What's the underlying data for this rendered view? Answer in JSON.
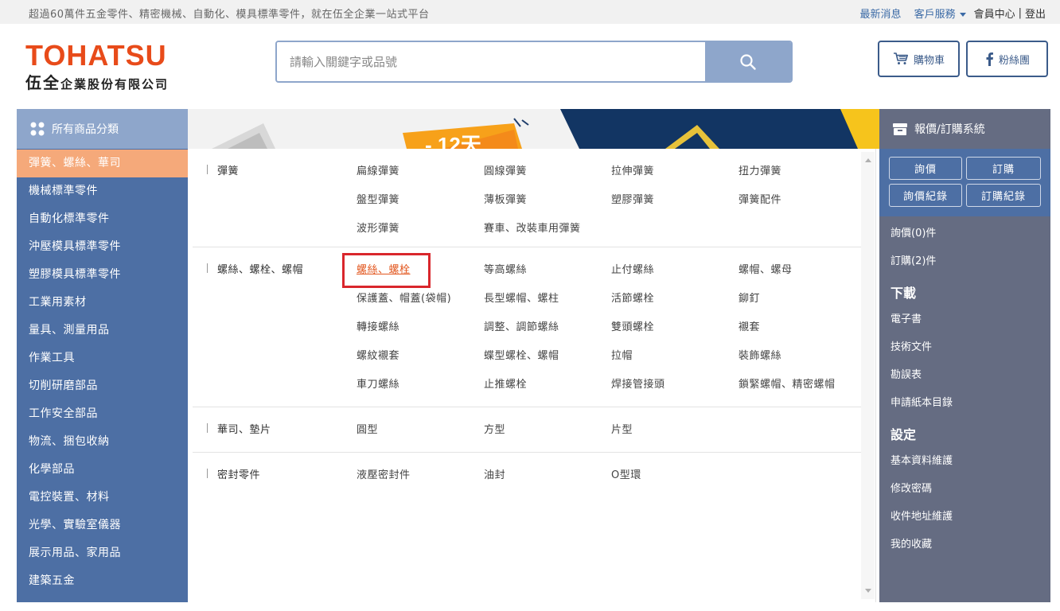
{
  "topbar": {
    "slogan": "超過60萬件五金零件、精密機械、自動化、模具標準零件，就在伍全企業一站式平台",
    "news": "最新消息",
    "service": "客戶服務",
    "member": "會員中心",
    "separator": "|",
    "logout": "登出"
  },
  "logo": {
    "brand": "TOHATSU",
    "company_big": "伍全",
    "company_rest": "企業股份有限公司"
  },
  "search": {
    "placeholder": "請輸入關鍵字或品號"
  },
  "header_buttons": {
    "cart": "購物車",
    "fans": "粉絲團"
  },
  "left_menu": {
    "title": "所有商品分類",
    "items": [
      "彈簧、螺絲、華司",
      "機械標準零件",
      "自動化標準零件",
      "沖壓模具標準零件",
      "塑膠模具標準零件",
      "工業用素材",
      "量具、測量用品",
      "作業工具",
      "切削研磨部品",
      "工作安全部品",
      "物流、捆包收納",
      "化學部品",
      "電控裝置、材料",
      "光學、實驗室儀器",
      "展示用品、家用品",
      "建築五金"
    ],
    "active_index": 0
  },
  "mega_menu": {
    "sections": [
      {
        "title": "彈簧",
        "items": [
          "扁線彈簧",
          "圓線彈簧",
          "拉伸彈簧",
          "扭力彈簧",
          "盤型彈簧",
          "薄板彈簧",
          "塑膠彈簧",
          "彈簧配件",
          "波形彈簧",
          "賽車、改裝車用彈簧"
        ]
      },
      {
        "title": "螺絲、螺栓、螺帽",
        "items": [
          "螺絲、螺栓",
          "等高螺絲",
          "止付螺絲",
          "螺帽、螺母",
          "保護蓋、帽蓋(袋帽)",
          "長型螺帽、螺柱",
          "活節螺栓",
          "鉚釘",
          "轉接螺絲",
          "調整、調節螺絲",
          "雙頭螺栓",
          "襯套",
          "螺紋襯套",
          "蝶型螺栓、螺帽",
          "拉帽",
          "裝飾螺絲",
          "車刀螺絲",
          "止推螺栓",
          "焊接管接頭",
          "鎖緊螺帽、精密螺帽"
        ],
        "highlighted_index": 0
      },
      {
        "title": "華司、墊片",
        "items": [
          "圓型",
          "方型",
          "片型"
        ]
      },
      {
        "title": "密封零件",
        "items": [
          "液壓密封件",
          "油封",
          "O型環"
        ]
      }
    ]
  },
  "right_bar": {
    "title": "報價/訂購系統",
    "buttons": [
      "詢價",
      "訂購",
      "詢價紀錄",
      "訂購紀錄"
    ],
    "inquiry_count": "詢價(0)件",
    "order_count": "訂購(2)件",
    "download_title": "下載",
    "download_items": [
      "電子書",
      "技術文件",
      "勘誤表",
      "申請紙本目錄"
    ],
    "settings_title": "設定",
    "settings_items": [
      "基本資料維護",
      "修改密碼",
      "收件地址維護",
      "我的收藏"
    ]
  },
  "colors": {
    "accent_orange": "#e84b1a",
    "nav_blue": "#4d6fa4",
    "active_item": "#f5a97a",
    "highlight_red": "#d9262c",
    "side_gray": "#656c82"
  }
}
